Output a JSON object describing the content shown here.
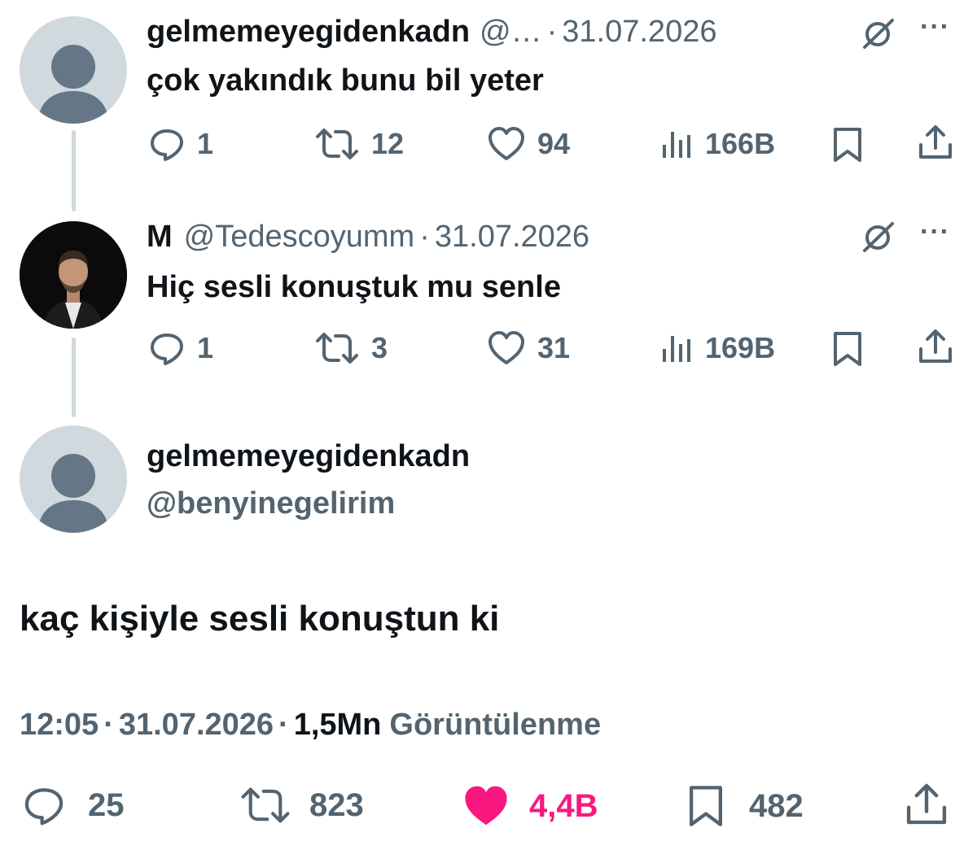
{
  "tweets": [
    {
      "name": "gelmemeyegidenkadn",
      "handle": "@…",
      "separator": "·",
      "date": "31.07.2026",
      "text": "çok yakındık bunu bil yeter",
      "replies": "1",
      "retweets": "12",
      "likes": "94",
      "views": "166B"
    },
    {
      "name": "M",
      "handle": "@Tedescoyumm",
      "separator": "·",
      "date": "31.07.2026",
      "text": "Hiç sesli konuştuk mu senle",
      "replies": "1",
      "retweets": "3",
      "likes": "31",
      "views": "169B"
    }
  ],
  "main": {
    "name": "gelmemeyegidenkadn",
    "handle": "@benyinegelirim",
    "text": "kaç kişiyle sesli konuştun ki",
    "time": "12:05",
    "sep1": "·",
    "date": "31.07.2026",
    "sep2": "·",
    "views_count": "1,5Mn",
    "views_label": "Görüntülenme",
    "replies": "25",
    "retweets": "823",
    "likes": "4,4B",
    "bookmarks": "482"
  },
  "icons": {
    "reply": "reply-icon",
    "retweet": "retweet-icon",
    "like": "heart-icon",
    "views": "views-icon",
    "bookmark": "bookmark-icon",
    "share": "share-icon",
    "grok": "grok-icon",
    "more": "more-icon"
  },
  "colors": {
    "text": "#0f1419",
    "muted": "#536471",
    "like_active": "#f91880",
    "avatar_default": "#cfd9de"
  }
}
